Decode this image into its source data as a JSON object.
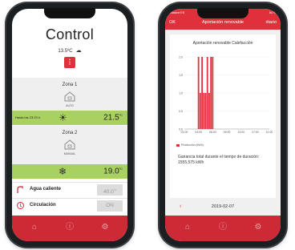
{
  "left_phone": {
    "title": "Control",
    "outside_temp": "13.5ºC",
    "weather_icon": "cloud-icon",
    "menu_button_icon": "dots-icon",
    "zones": [
      {
        "name": "Zona 1",
        "mode": "AUTO",
        "bar_text": "Hasta las 23:20 h",
        "temperature": "21.5",
        "unit": "ºC",
        "bar_color": "#a9d15f",
        "mode_icon": "sun-icon"
      },
      {
        "name": "Zona 2",
        "mode": "MANUAL",
        "bar_text": "",
        "temperature": "19.0",
        "unit": "ºC",
        "bar_color": "#a9d15f",
        "mode_icon": "snowflake-icon"
      }
    ],
    "options": [
      {
        "label": "Agua caliente",
        "value": "40.0",
        "unit": "ºC"
      },
      {
        "label": "Circulación",
        "value": "ON"
      }
    ],
    "bottom_icons": [
      "home-icon",
      "info-icon",
      "settings-icon"
    ],
    "accent": "#cd2a36"
  },
  "right_phone": {
    "status_carrier": "vodafone ES",
    "status_time": "10:57",
    "status_battery": "84 %",
    "nav_left": "OK",
    "nav_title": "Aportación renovable",
    "nav_right": "diario",
    "chart_title": "Aportación renovable Calefacción",
    "legend": "Producción (kWh)",
    "gain_text": "Ganancia total durante el tiempo de duración: 1555,575 kWh",
    "date": "2019-02-07",
    "back_arrow": "‹",
    "bottom_icons": [
      "home-icon",
      "info-icon",
      "settings-icon"
    ]
  },
  "chart_data": {
    "type": "bar",
    "title": "Aportación renovable Calefacción",
    "x_tick_labels": [
      "01:00",
      "04:00",
      "06:00",
      "09:00",
      "13:00",
      "17:00",
      "21:00"
    ],
    "y_tick_labels": [
      "0,0",
      "0,5",
      "1,0",
      "1,5",
      "2,0"
    ],
    "ylim": [
      0,
      2.0
    ],
    "series": [
      {
        "name": "Producción (kWh)",
        "x": [
          4.0,
          4.5,
          5.0,
          5.5,
          6.0,
          6.5,
          7.0,
          7.5,
          8.0
        ],
        "values": [
          2.0,
          1.0,
          2.0,
          1.0,
          1.0,
          2.0,
          1.0,
          2.0,
          2.0
        ]
      }
    ],
    "xlim": [
      0,
      24
    ],
    "color": "#e0303c"
  }
}
